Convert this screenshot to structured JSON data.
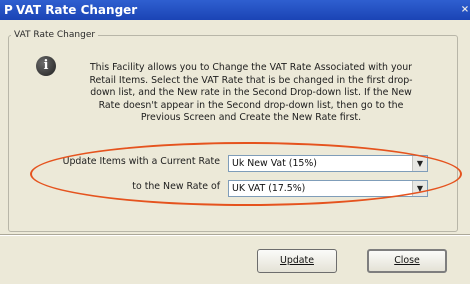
{
  "window": {
    "title": "VAT Rate Changer",
    "app_icon": "P",
    "close_glyph": "×"
  },
  "group": {
    "legend": "VAT Rate Changer"
  },
  "info_icon": {
    "name": "info-icon",
    "glyph": "i"
  },
  "description": "This Facility allows you to Change the VAT Rate Associated with your Retail Items. Select the VAT Rate that is be changed in the first drop-down list, and the New rate in the Second Drop-down list. If the New Rate doesn't appear in the Second drop-down list, then go to the Previous Screen and Create the New Rate first.",
  "form": {
    "current_rate_label": "Update Items with a Current Rate",
    "current_rate_value": "Uk New Vat (15%)",
    "new_rate_label": "to the New Rate of",
    "new_rate_value": "UK VAT (17.5%)",
    "dropdown_arrow": "▼"
  },
  "buttons": {
    "update": "Update",
    "close": "Close"
  },
  "colors": {
    "titlebar": "#2f5fd0",
    "highlight": "#e5531e",
    "face": "#ece9d8"
  }
}
